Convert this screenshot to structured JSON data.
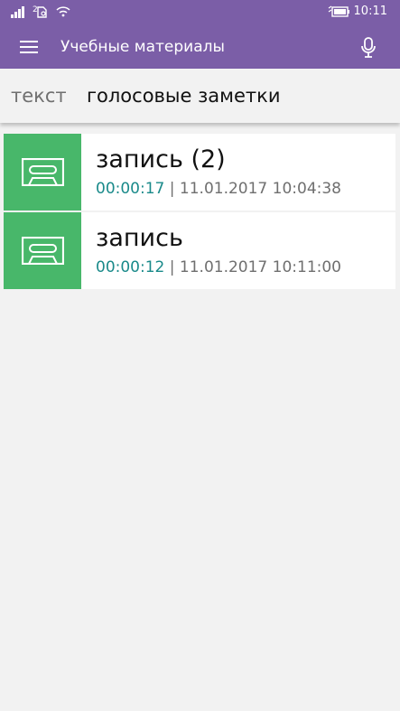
{
  "status_bar": {
    "time": "10:11",
    "icons": [
      "signal-icon",
      "sim-icon",
      "wifi-icon",
      "battery-icon"
    ]
  },
  "app_bar": {
    "title": "Учебные материалы",
    "menu_icon": "hamburger-menu-icon",
    "mic_icon": "microphone-icon"
  },
  "pivot": {
    "tabs": [
      {
        "label": "текст",
        "selected": false
      },
      {
        "label": "голосовые заметки",
        "selected": true
      }
    ]
  },
  "recordings": [
    {
      "title": "запись (2)",
      "duration": "00:00:17",
      "separator": "|",
      "date": "11.01.2017 10:04:38",
      "icon": "cassette-icon"
    },
    {
      "title": "запись",
      "duration": "00:00:12",
      "separator": "|",
      "date": "11.01.2017 10:11:00",
      "icon": "cassette-icon"
    }
  ],
  "colors": {
    "accent": "#7b5ea7",
    "thumbnail": "#48b76a",
    "duration_text": "#1a8a8a",
    "background": "#f2f2f2"
  }
}
